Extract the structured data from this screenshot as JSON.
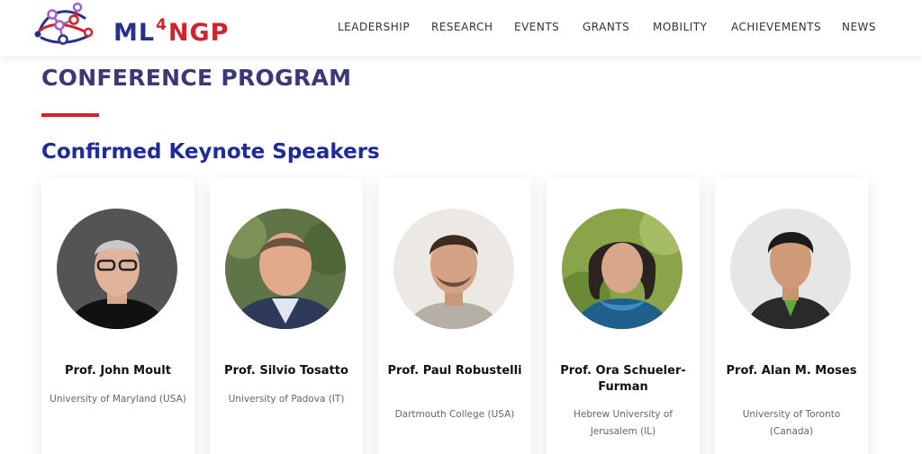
{
  "brand": {
    "prefix": "ML",
    "sup": "4",
    "suffix": "NGP"
  },
  "nav": [
    "LEADERSHIP",
    "RESEARCH",
    "EVENTS",
    "GRANTS",
    "MOBILITY",
    "ACHIEVEMENTS",
    "NEWS"
  ],
  "page_title": "CONFERENCE PROGRAM",
  "section_title": "Confirmed Keynote Speakers",
  "speakers": [
    {
      "name": "Prof. John Moult",
      "affiliation": "University of Maryland (USA)"
    },
    {
      "name": "Prof. Silvio Tosatto",
      "affiliation": "University of Padova (IT)"
    },
    {
      "name": "Prof. Paul Robustelli",
      "affiliation": "Dartmouth College (USA)"
    },
    {
      "name": "Prof. Ora Schueler-Furman",
      "affiliation": "Hebrew University of Jerusalem (IL)"
    },
    {
      "name": "Prof. Alan M. Moses",
      "affiliation": "University of Toronto (Canada)"
    }
  ],
  "colors": {
    "brand_blue": "#2b2f8c",
    "brand_red": "#d4212d",
    "title": "#3a3876",
    "section": "#1f2a9b"
  }
}
